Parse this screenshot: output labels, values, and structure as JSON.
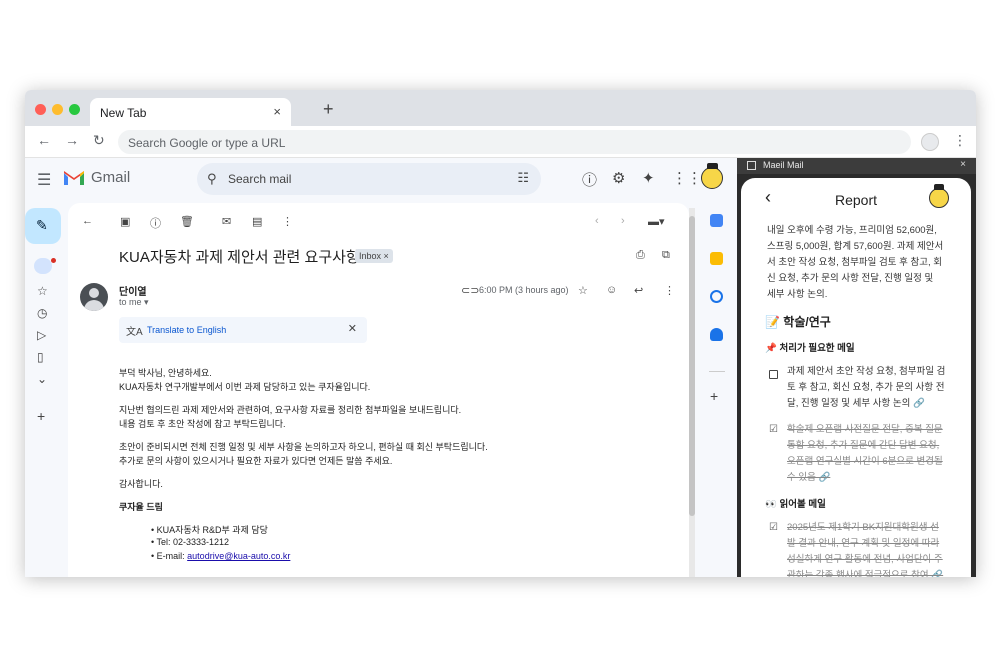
{
  "browser": {
    "tab_title": "New Tab",
    "tab_close": "×",
    "new_tab": "+",
    "omnibox_placeholder": "Search Google or type a URL",
    "back": "←",
    "forward": "→",
    "reload": "↻",
    "menu": "⋮",
    "traffic_colors": [
      "#ff5f57",
      "#febc2e",
      "#28c840"
    ]
  },
  "gmail": {
    "app_name": "Gmail",
    "search_placeholder": "Search mail",
    "logo_colors": [
      "#ea4335",
      "#fbbc04",
      "#34a853",
      "#4285f4"
    ]
  },
  "email": {
    "subject": "KUA자동차 과제 제안서 관련 요구사항",
    "label": "Inbox ×",
    "sender": "단이열",
    "to": "to me ▾",
    "time": "6:00 PM (3 hours ago)",
    "translate": "Translate to English",
    "body": [
      "부덕 박사님, 안녕하세요.",
      "KUA자동차 연구개발부에서 이번 과제 담당하고 있는 쿠자율입니다.",
      "지난번 협의드린 과제 제안서와 관련하여, 요구사항 자료를 정리한 첨부파일을 보내드립니다.",
      "내용 검토 후 초안 작성에 참고 부탁드립니다.",
      "초안이 준비되시면 전체 진행 일정 및 세부 사항을 논의하고자 하오니, 편하실 때 회신 부탁드립니다.",
      "추가로 문의 사항이 있으시거나 필요한 자료가 있다면 언제든 말씀 주세요.",
      "감사합니다.",
      "쿠자율 드림"
    ],
    "signature": [
      "KUA자동차 R&D부 과제 담당",
      "Tel: 02-3333-1212",
      "E-mail: "
    ],
    "email_link": "autodrive@kua-auto.co.kr"
  },
  "extension": {
    "name": "Maeil Mail",
    "close": "×",
    "report_title": "Report",
    "intro_lines": [
      "내일 오후에 수령 가능, 프리미엄 52,600원,",
      "스프링 5,000원, 합계 57,600원. 과제 제안서",
      "서 초안 작성 요청, 첨부파일 검토 후 참고, 회",
      "신 요청, 추가 문의 사항 전달, 진행 일정 및",
      "세부 사항 논의."
    ],
    "section": "📝 학술/연구",
    "sub1": "📌 처리가 필요한 메일",
    "task1": [
      "과제 제안서 초안 작성 요청, 첨부파일 검",
      "토 후 참고, 회신 요청, 추가 문의 사항 전",
      "달, 진행 일정 및 세부 사항 논의 🔗"
    ],
    "task2": [
      "학술제 오픈랩 사전질문 전달, 중복 질문",
      "통합 요청, 추가 질문에 간단 답변 요청,",
      "오픈랩 연구실별 시간이 6분으로 변경될",
      "수 있음 🔗"
    ],
    "sub2": "👀 읽어볼 메일",
    "task3": [
      "2025년도 제1학기 BK지원대학원생 선",
      "발 결과 안내, 연구 계획 및 일정에 따라",
      "성실하게 연구 활동에 전념, 사업단이 주",
      "관하는 각종 행사에 적극적으로 참여 🔗"
    ]
  }
}
